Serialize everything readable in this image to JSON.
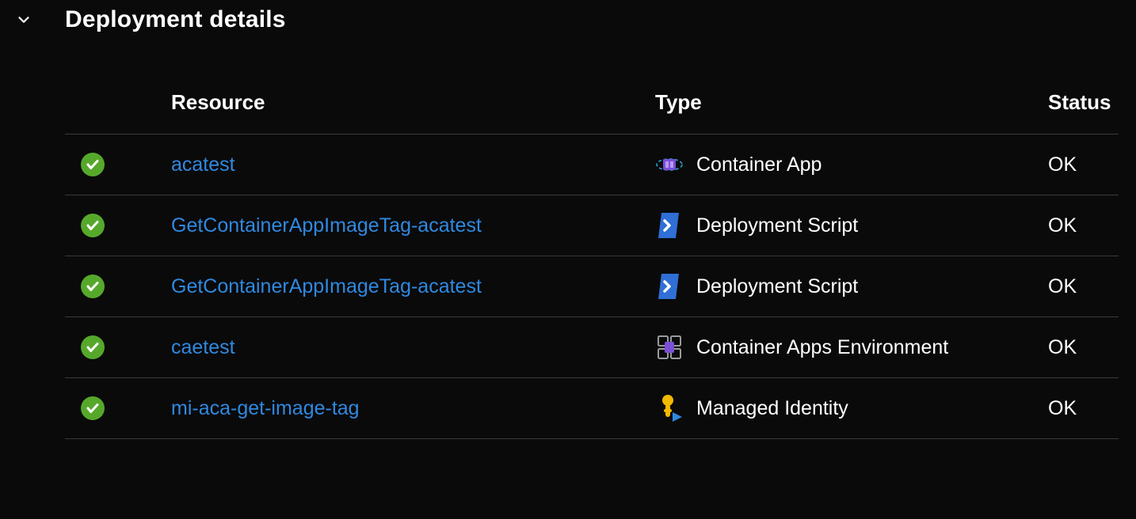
{
  "section": {
    "title": "Deployment details"
  },
  "table": {
    "headers": {
      "resource": "Resource",
      "type": "Type",
      "status": "Status"
    },
    "rows": [
      {
        "resource": "acatest",
        "type": "Container App",
        "icon": "container-app",
        "status": "OK"
      },
      {
        "resource": "GetContainerAppImageTag-acatest",
        "type": "Deployment Script",
        "icon": "deployment-script",
        "status": "OK"
      },
      {
        "resource": "GetContainerAppImageTag-acatest",
        "type": "Deployment Script",
        "icon": "deployment-script",
        "status": "OK"
      },
      {
        "resource": "caetest",
        "type": "Container Apps Environment",
        "icon": "container-apps-environment",
        "status": "OK"
      },
      {
        "resource": "mi-aca-get-image-tag",
        "type": "Managed Identity",
        "icon": "managed-identity",
        "status": "OK"
      }
    ]
  }
}
